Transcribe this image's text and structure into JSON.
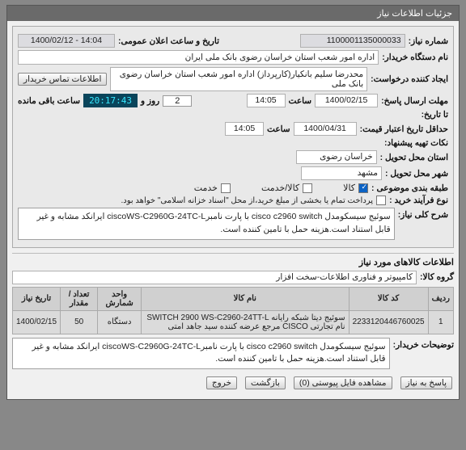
{
  "titlebar": "جزئیات اطلاعات نیاز",
  "contact_button": "اطلاعات تماس خریدار",
  "announce": {
    "label": "تاریخ و ساعت اعلان عمومی:",
    "value": "1400/02/12 - 14:04"
  },
  "need_no": {
    "label": "شماره نیاز:",
    "value": "1100001135000033"
  },
  "buyer_org": {
    "label": "نام دستگاه خریدار:",
    "value": "اداره امور شعب استان خراسان رضوی بانک ملی ایران"
  },
  "creator": {
    "label": "ایجاد کننده درخواست:",
    "value": "محدرضا سلیم  بانکیار(کارپرداز) اداره امور شعب استان خراسان رضوی بانک ملی"
  },
  "deadline": {
    "label": "مهلت ارسال پاسخ:",
    "date": "1400/02/15",
    "time_label": "ساعت",
    "time": "14:05",
    "days": "2",
    "days_label": "روز و",
    "countdown": "20:17:43",
    "remaining_label": "ساعت باقی مانده"
  },
  "to_date": {
    "label": "تا تاریخ:"
  },
  "valid": {
    "label": "حداقل تاریخ اعتبار قیمت:",
    "date": "1400/04/31",
    "time_label": "ساعت",
    "time": "14:05"
  },
  "tips": {
    "label": "نکات تهیه پیشنهاد:"
  },
  "province": {
    "label": "استان محل تحویل :",
    "value": "خراسان رضوی"
  },
  "city": {
    "label": "شهر محل تحویل :",
    "value": "مشهد"
  },
  "grouping": {
    "label": "طبقه بندی موضوعی :",
    "goods": "کالا",
    "goods_svc": "کالا/خدمت",
    "service": "خدمت"
  },
  "process": {
    "label": "نوع فرآیند خرید :",
    "note": "پرداخت تمام یا بخشی از مبلغ خرید،از محل \"اسناد خزانه اسلامی\" خواهد بود."
  },
  "desc": {
    "label": "شرح کلی نیاز:",
    "text": "سوئیج سیسکومدل cisco c2960 switch با پارت نامبرciscoWS-C2960G-24TC-L ایرانکد مشابه و غیر قابل استناد است.هزینه حمل با تامین کننده است."
  },
  "items_title": "اطلاعات کالاهای مورد نیاز",
  "group": {
    "label": "گروه کالا:",
    "value": "کامپیوتر و فناوری اطلاعات-سخت افزار"
  },
  "table": {
    "headers": {
      "row": "ردیف",
      "code": "کد کالا",
      "name": "نام کالا",
      "unit": "واحد شمارش",
      "qty": "تعداد / مقدار",
      "date": "تاریخ نیاز"
    },
    "rows": [
      {
        "row": "1",
        "code": "2233120446760025",
        "name": "سوئیج دیتا شبکه رایانه SWITCH 2900 WS-C2960-24TT-L نام تجارتی CISCO مرجع عرضه کننده سید جاهد امتی",
        "unit": "دستگاه",
        "qty": "50",
        "date": "1400/02/15"
      }
    ]
  },
  "buyer_desc": {
    "label": "توضیحات خریدار:",
    "text": "سوئیج سیسکومدل cisco c2960 switch با پارت نامبرciscoWS-C2960G-24TC-L ایرانکد مشابه و غیر قابل استناد است.هزینه حمل با تامین کننده است."
  },
  "buttons": {
    "answer": "پاسخ به نیاز",
    "files": "مشاهده فایل پیوستی (0)",
    "back": "بازگشت",
    "exit": "خروج"
  }
}
